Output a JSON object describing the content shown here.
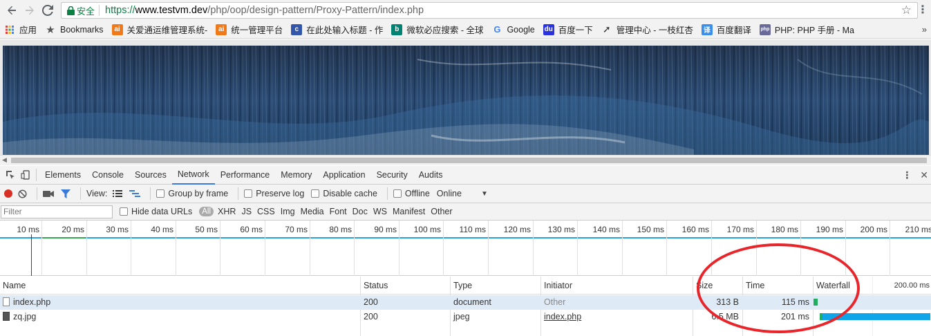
{
  "browser": {
    "secure_label": "安全",
    "url_scheme": "https://",
    "url_host": "www.testvm.dev",
    "url_path": "/php/oop/design-pattern/Proxy-Pattern/index.php"
  },
  "bookmarks": [
    {
      "label": "应用",
      "icon": "apps-grid-icon",
      "color": "#e04040"
    },
    {
      "label": "Bookmarks",
      "icon": "star-icon",
      "color": "#555555"
    },
    {
      "label": "关爱通运维管理系统-",
      "icon": "ai-logo-icon",
      "color": "#f07a1a"
    },
    {
      "label": "统一管理平台",
      "icon": "ai-logo-icon",
      "color": "#f07a1a"
    },
    {
      "label": "在此处输入标题 - 作",
      "icon": "blog-icon",
      "color": "#3355aa"
    },
    {
      "label": "微软必应搜索 - 全球",
      "icon": "bing-icon",
      "color": "#008373"
    },
    {
      "label": "Google",
      "icon": "google-icon",
      "color": "#4285f4"
    },
    {
      "label": "百度一下",
      "icon": "baidu-icon",
      "color": "#2932e1"
    },
    {
      "label": "管理中心 - 一枝红杏",
      "icon": "paper-plane-icon",
      "color": "#333333"
    },
    {
      "label": "百度翻译",
      "icon": "translate-icon",
      "color": "#3b8fea"
    },
    {
      "label": "PHP: PHP 手册 - Ma",
      "icon": "php-icon",
      "color": "#6a6a9a"
    }
  ],
  "devtools": {
    "tabs": [
      "Elements",
      "Console",
      "Sources",
      "Network",
      "Performance",
      "Memory",
      "Application",
      "Security",
      "Audits"
    ],
    "active_tab": "Network",
    "toolbar": {
      "view_label": "View:",
      "group_by_frame": "Group by frame",
      "preserve_log": "Preserve log",
      "disable_cache": "Disable cache",
      "offline": "Offline",
      "throttle": "Online"
    },
    "filter": {
      "placeholder": "Filter",
      "hide_data_urls": "Hide data URLs",
      "types": [
        "All",
        "XHR",
        "JS",
        "CSS",
        "Img",
        "Media",
        "Font",
        "Doc",
        "WS",
        "Manifest",
        "Other"
      ]
    },
    "overview_ticks": [
      "10 ms",
      "20 ms",
      "30 ms",
      "40 ms",
      "50 ms",
      "60 ms",
      "70 ms",
      "80 ms",
      "90 ms",
      "100 ms",
      "110 ms",
      "120 ms",
      "130 ms",
      "140 ms",
      "150 ms",
      "160 ms",
      "170 ms",
      "180 ms",
      "190 ms",
      "200 ms",
      "210 ms"
    ],
    "columns": {
      "name": "Name",
      "status": "Status",
      "type": "Type",
      "initiator": "Initiator",
      "size": "Size",
      "time": "Time",
      "waterfall": "Waterfall",
      "waterfall_scale": "200.00 ms"
    },
    "requests": [
      {
        "name": "index.php",
        "status": "200",
        "type": "document",
        "initiator": "Other",
        "size": "313 B",
        "time": "115 ms",
        "wf_start_ms": 0,
        "wf_end_ms": 115
      },
      {
        "name": "zq.jpg",
        "status": "200",
        "type": "jpeg",
        "initiator": "index.php",
        "size": "6.5 MB",
        "time": "201 ms",
        "wf_start_ms": 10,
        "wf_end_ms": 201
      }
    ]
  },
  "colors": {
    "accent": "#3879d9",
    "record": "#d93025",
    "annotation": "#e8252a",
    "waterfall_waiting": "#1fae5e",
    "waterfall_download": "#0ea5e9"
  }
}
